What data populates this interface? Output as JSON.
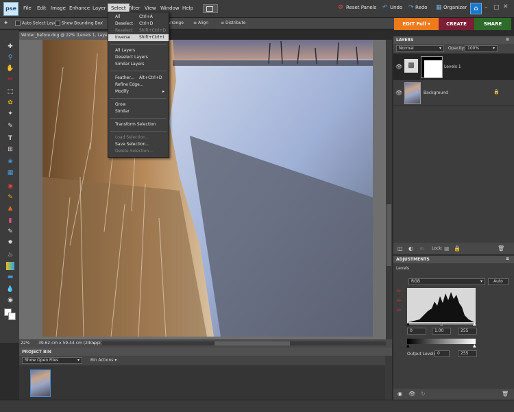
{
  "app": {
    "logo_text": "pse"
  },
  "menubar": {
    "items": [
      "File",
      "Edit",
      "Image",
      "Enhance",
      "Layer",
      "Select",
      "Filter",
      "View",
      "Window",
      "Help"
    ],
    "right": {
      "reset_panels": "Reset Panels",
      "undo": "Undo",
      "redo": "Redo",
      "organizer": "Organizer"
    }
  },
  "options_bar": {
    "auto_select_layer": "Auto Select Layer",
    "show_bounding_box": "Show Bounding Box",
    "arrange": "Arrange",
    "align": "Align",
    "distribute": "Distribute"
  },
  "mode_tabs": {
    "edit": "EDIT Full",
    "create": "CREATE",
    "share": "SHARE"
  },
  "document": {
    "tab_title": "Winter_before.dng @ 22% (Levels 1, Layer Mask/8)"
  },
  "select_menu": {
    "items": [
      {
        "label": "All",
        "shortcut": "Ctrl+A",
        "enabled": true
      },
      {
        "label": "Deselect",
        "shortcut": "Ctrl+D",
        "enabled": true
      },
      {
        "label": "Reselect",
        "shortcut": "Shift+Ctrl+D",
        "enabled": false
      },
      {
        "label": "Inverse",
        "shortcut": "Shift+Ctrl+I",
        "enabled": true,
        "highlighted": true
      },
      {
        "label": "All Layers",
        "shortcut": "",
        "enabled": true
      },
      {
        "label": "Deselect Layers",
        "shortcut": "",
        "enabled": true
      },
      {
        "label": "Similar Layers",
        "shortcut": "",
        "enabled": true
      },
      {
        "label": "Feather...",
        "shortcut": "Alt+Ctrl+D",
        "enabled": true
      },
      {
        "label": "Refine Edge...",
        "shortcut": "",
        "enabled": true
      },
      {
        "label": "Modify",
        "shortcut": "",
        "enabled": true,
        "submenu": true
      },
      {
        "label": "Grow",
        "shortcut": "",
        "enabled": true
      },
      {
        "label": "Similar",
        "shortcut": "",
        "enabled": true
      },
      {
        "label": "Transform Selection",
        "shortcut": "",
        "enabled": true
      },
      {
        "label": "Load Selection...",
        "shortcut": "",
        "enabled": false
      },
      {
        "label": "Save Selection...",
        "shortcut": "",
        "enabled": true
      },
      {
        "label": "Delete Selection...",
        "shortcut": "",
        "enabled": false
      }
    ]
  },
  "status_bar": {
    "zoom": "22%",
    "dimensions": "39.62 cm x 59.44 cm (240 ppi)"
  },
  "project_bin": {
    "title": "PROJECT BIN",
    "show_select": "Show Open Files",
    "bin_actions": "Bin Actions"
  },
  "layers_panel": {
    "title": "LAYERS",
    "blend_mode": "Normal",
    "opacity_label": "Opacity:",
    "opacity_value": "100%",
    "lock_label": "Lock:",
    "layers": [
      {
        "name": "Levels 1"
      },
      {
        "name": "Background"
      }
    ]
  },
  "adjustments_panel": {
    "title": "ADJUSTMENTS",
    "name": "Levels",
    "channel": "RGB",
    "auto": "Auto",
    "input": {
      "black": "0",
      "gamma": "1.00",
      "white": "255"
    },
    "output_label": "Output Levels:",
    "output": {
      "black": "0",
      "white": "255"
    }
  },
  "colors": {
    "edit_tab": "#f07a1a",
    "create_tab": "#7c1f36",
    "share_tab": "#2e6b2a",
    "accent_blue": "#1b78c8"
  }
}
